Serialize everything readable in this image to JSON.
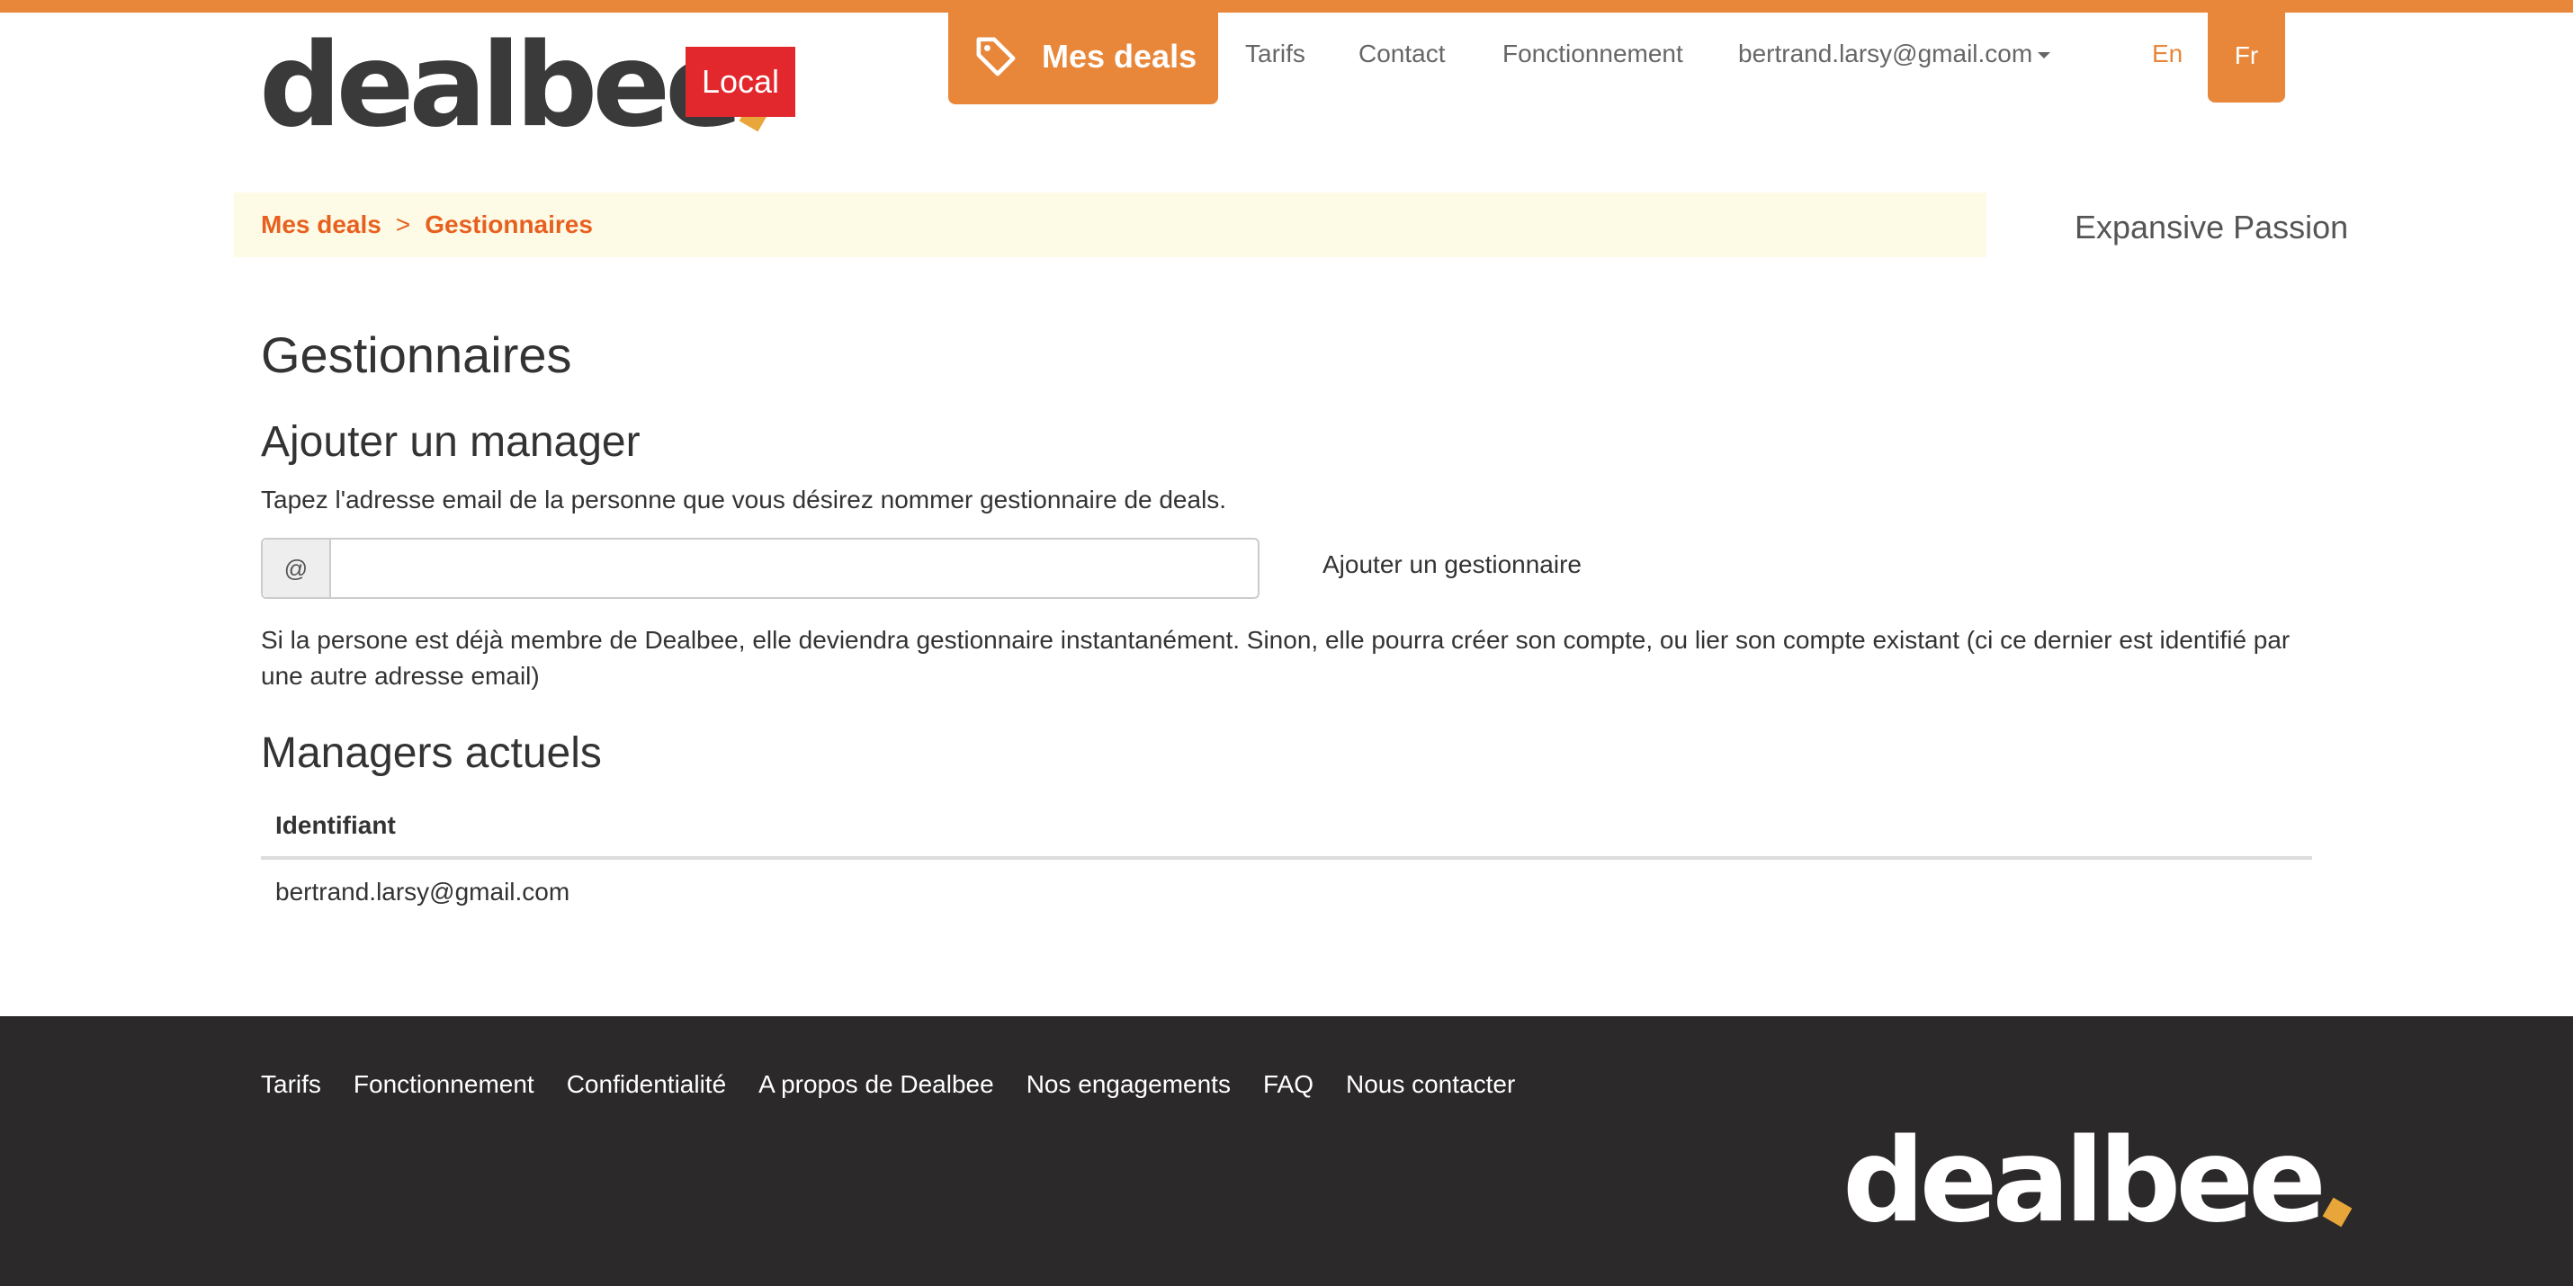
{
  "header": {
    "logo_text": "dealbee",
    "logo_badge": "Local",
    "nav": {
      "mes_deals": "Mes deals",
      "tarifs": "Tarifs",
      "contact": "Contact",
      "fonctionnement": "Fonctionnement",
      "account": "bertrand.larsy@gmail.com"
    },
    "lang": {
      "en": "En",
      "fr": "Fr"
    },
    "icons": {
      "mes_deals": "tag-icon",
      "account": "caret-down-icon"
    }
  },
  "breadcrumb": {
    "items": [
      "Mes deals",
      "Gestionnaires"
    ],
    "separator": ">"
  },
  "org_name": "Expansive Passion",
  "main": {
    "title": "Gestionnaires",
    "add_section": {
      "title": "Ajouter un manager",
      "description": "Tapez l'adresse email de la personne que vous désirez nommer gestionnaire de deals.",
      "input_addon": "@",
      "input_value": "",
      "button_label": "Ajouter un gestionnaire",
      "info": "Si la persone est déjà membre de Dealbee, elle deviendra gestionnaire instantanément. Sinon, elle pourra créer son compte, ou lier son compte existant (ci ce dernier est identifié par une autre adresse email)"
    },
    "managers_section": {
      "title": "Managers actuels",
      "columns": [
        "Identifiant"
      ],
      "rows": [
        [
          "bertrand.larsy@gmail.com"
        ]
      ]
    }
  },
  "footer": {
    "links": [
      "Tarifs",
      "Fonctionnement",
      "Confidentialité",
      "A propos de Dealbee",
      "Nos engagements",
      "FAQ",
      "Nous contacter"
    ],
    "logo_text": "dealbee"
  },
  "colors": {
    "accent": "#e8873a",
    "badge": "#e2282d",
    "breadcrumb_bg": "#fdfbe6",
    "footer_bg": "#2b292a"
  }
}
